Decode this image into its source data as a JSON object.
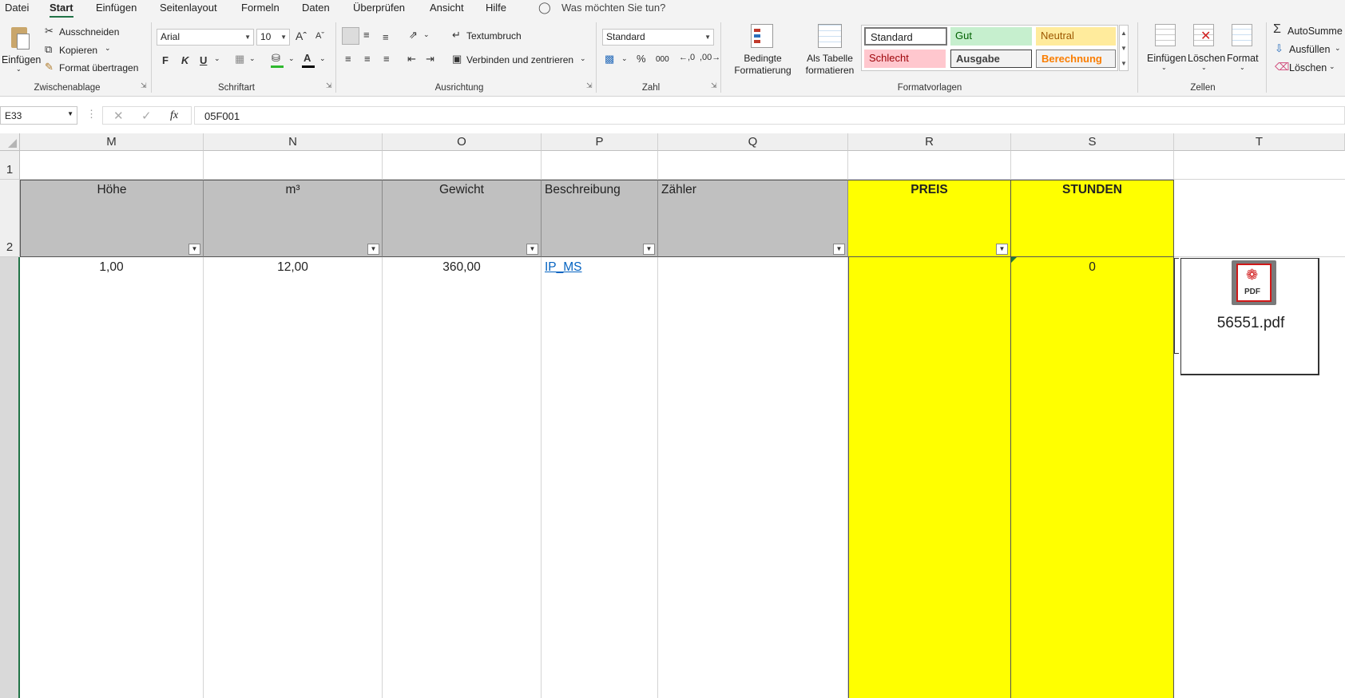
{
  "tabs": [
    "Datei",
    "Start",
    "Einfügen",
    "Seitenlayout",
    "Formeln",
    "Daten",
    "Überprüfen",
    "Ansicht",
    "Hilfe"
  ],
  "tell_me": "Was möchten Sie tun?",
  "ribbon": {
    "clipboard": {
      "paste": "Einfügen",
      "cut": "Ausschneiden",
      "copy": "Kopieren",
      "format_painter": "Format übertragen",
      "group": "Zwischenablage"
    },
    "font": {
      "name": "Arial",
      "size": "10",
      "bold": "F",
      "italic": "K",
      "underline": "U",
      "group": "Schriftart"
    },
    "alignment": {
      "wrap": "Textumbruch",
      "merge": "Verbinden und zentrieren",
      "group": "Ausrichtung"
    },
    "number": {
      "format": "Standard",
      "percent": "%",
      "thousands": "000",
      "group": "Zahl"
    },
    "styles": {
      "conditional_1": "Bedingte",
      "conditional_2": "Formatierung",
      "table_1": "Als Tabelle",
      "table_2": "formatieren",
      "standard": "Standard",
      "gut": "Gut",
      "neutral": "Neutral",
      "schlecht": "Schlecht",
      "ausgabe": "Ausgabe",
      "berechnung": "Berechnung",
      "group": "Formatvorlagen"
    },
    "cells": {
      "insert": "Einfügen",
      "delete": "Löschen",
      "format": "Format",
      "group": "Zellen"
    },
    "editing": {
      "autosum": "AutoSumme",
      "fill": "Ausfüllen",
      "clear": "Löschen"
    }
  },
  "formula_bar": {
    "name_box": "E33",
    "fx": "fx",
    "content": "05F001"
  },
  "columns": [
    "M",
    "N",
    "O",
    "P",
    "Q",
    "R",
    "S",
    "T"
  ],
  "rows": [
    "1",
    "2"
  ],
  "headers": {
    "m": "Höhe",
    "n": "m³",
    "o": "Gewicht",
    "p": "Beschreibung",
    "q": "Zähler",
    "r": "PREIS",
    "s": "STUNDEN"
  },
  "row3": {
    "m": "1,00",
    "n": "12,00",
    "o": "360,00",
    "p": "IP_MS",
    "q": "",
    "r": "",
    "s": "0"
  },
  "attachment": {
    "name": "56551.pdf",
    "icon_text": "PDF"
  },
  "colors": {
    "accent": "#217346",
    "yellow": "#ffff00",
    "header_gray": "#c0c0c0",
    "link": "#0563c1"
  }
}
